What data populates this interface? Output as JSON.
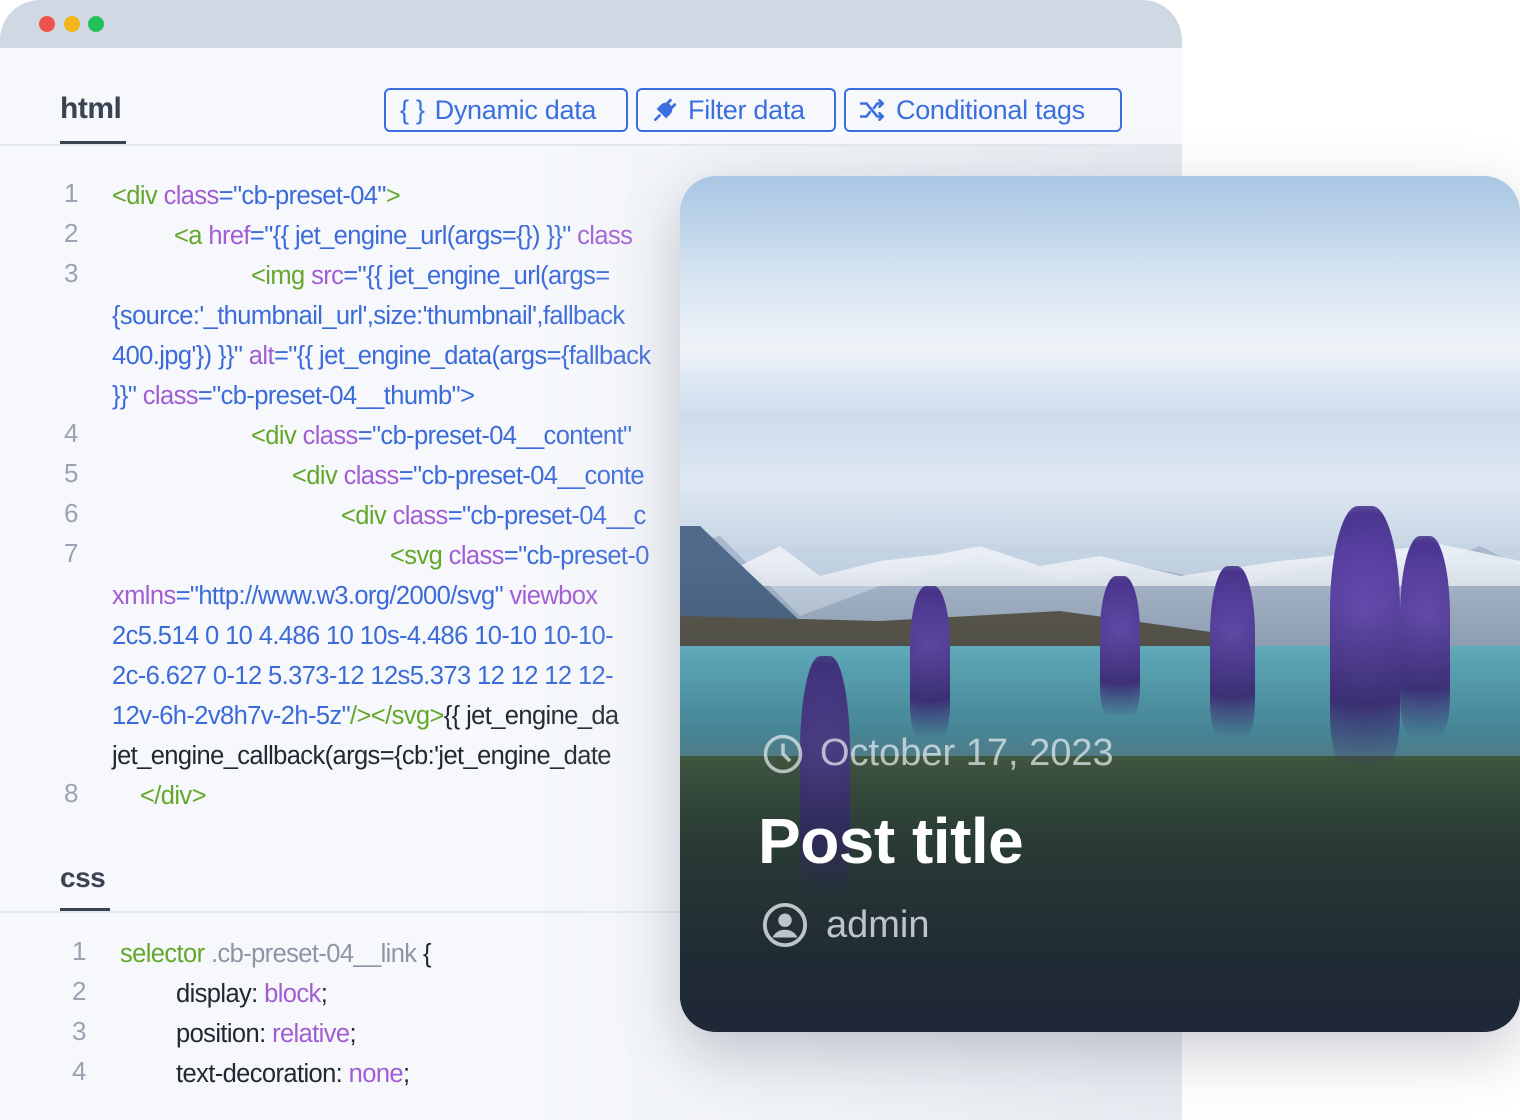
{
  "window": {
    "dots": [
      "#f0524f",
      "#f0b61a",
      "#22c05a"
    ]
  },
  "html_section": {
    "label": "html",
    "buttons": [
      {
        "label": "Dynamic data",
        "icon": "curly-braces-icon",
        "glyph": "{ }"
      },
      {
        "label": "Filter data",
        "icon": "plug-icon"
      },
      {
        "label": "Conditional tags",
        "icon": "shuffle-icon"
      }
    ],
    "lines": [
      {
        "num": "1",
        "indent": 0,
        "segs": [
          [
            "<div ",
            "tag"
          ],
          [
            "class",
            "attr"
          ],
          [
            "=\"cb-preset-04\"",
            "val"
          ],
          [
            ">",
            "tag"
          ]
        ]
      },
      {
        "num": "2",
        "indent": 1,
        "segs": [
          [
            "<a ",
            "tag"
          ],
          [
            "href",
            "attr"
          ],
          [
            "=\"{{ jet_engine_url(args={}) }}\" ",
            "val"
          ],
          [
            "class",
            "attr"
          ]
        ]
      },
      {
        "num": "3",
        "indent": 2,
        "segs": [
          [
            "<img ",
            "tag"
          ],
          [
            "src",
            "attr"
          ],
          [
            "=\"{{ jet_engine_url(args=",
            "val"
          ]
        ]
      },
      {
        "num": "",
        "indent": -1,
        "segs": [
          [
            "{source:'_thumbnail_url',size:'thumbnail',fallback",
            "val"
          ]
        ]
      },
      {
        "num": "",
        "indent": -1,
        "segs": [
          [
            "400.jpg'}) }}\" ",
            "val"
          ],
          [
            "alt",
            "attr"
          ],
          [
            "=\"{{ jet_engine_data(args={fallback",
            "val"
          ]
        ]
      },
      {
        "num": "",
        "indent": -1,
        "segs": [
          [
            "}}\" ",
            "val"
          ],
          [
            "class",
            "attr"
          ],
          [
            "=\"cb-preset-04__thumb\"",
            "val"
          ],
          [
            ">",
            "val"
          ]
        ]
      },
      {
        "num": "4",
        "indent": 2,
        "segs": [
          [
            "<div ",
            "tag"
          ],
          [
            "class",
            "attr"
          ],
          [
            "=\"cb-preset-04__content\"",
            "val"
          ]
        ]
      },
      {
        "num": "5",
        "indent": 3,
        "segs": [
          [
            "<div ",
            "tag"
          ],
          [
            "class",
            "attr"
          ],
          [
            "=\"cb-preset-04__conte",
            "val"
          ]
        ]
      },
      {
        "num": "6",
        "indent": 4,
        "segs": [
          [
            "<div ",
            "tag"
          ],
          [
            "class",
            "attr"
          ],
          [
            "=\"cb-preset-04__c",
            "val"
          ]
        ]
      },
      {
        "num": "7",
        "indent": 5,
        "segs": [
          [
            "<svg ",
            "tag"
          ],
          [
            "class",
            "attr"
          ],
          [
            "=\"cb-preset-0",
            "val"
          ]
        ]
      },
      {
        "num": "",
        "indent": -1,
        "segs": [
          [
            "xmlns",
            "attr"
          ],
          [
            "=\"http://www.w3.org/2000/svg\" ",
            "val"
          ],
          [
            "viewbox",
            "attr"
          ]
        ]
      },
      {
        "num": "",
        "indent": -1,
        "segs": [
          [
            "2c5.514 0 10 4.486 10 10s-4.486 10-10 10-10-",
            "val"
          ]
        ]
      },
      {
        "num": "",
        "indent": -1,
        "segs": [
          [
            "2c-6.627 0-12 5.373-12 12s5.373 12 12 12 12-",
            "val"
          ]
        ]
      },
      {
        "num": "",
        "indent": -1,
        "segs": [
          [
            "12v-6h-2v8h7v-2h-5z\"",
            "val"
          ],
          [
            "/></svg>",
            "tag"
          ],
          [
            "{{ jet_engine_da",
            "plain"
          ]
        ]
      },
      {
        "num": "",
        "indent": -1,
        "segs": [
          [
            "jet_engine_callback(args={cb:'jet_engine_date",
            "plain"
          ]
        ]
      },
      {
        "num": "8",
        "indent": 6,
        "segs": [
          [
            "</div>",
            "tag"
          ]
        ]
      }
    ]
  },
  "css_section": {
    "label": "css",
    "lines": [
      {
        "num": "1",
        "indent": 0,
        "segs": [
          [
            "selector ",
            "tag"
          ],
          [
            ".cb-preset-04__link ",
            "sel"
          ],
          [
            "{",
            "plain"
          ]
        ]
      },
      {
        "num": "2",
        "indent": 1,
        "segs": [
          [
            "display: ",
            "plain"
          ],
          [
            "block",
            "attr"
          ],
          [
            ";",
            "plain"
          ]
        ]
      },
      {
        "num": "3",
        "indent": 1,
        "segs": [
          [
            "position: ",
            "plain"
          ],
          [
            "relative",
            "attr"
          ],
          [
            ";",
            "plain"
          ]
        ]
      },
      {
        "num": "4",
        "indent": 1,
        "segs": [
          [
            "text-decoration: ",
            "plain"
          ],
          [
            "none",
            "attr"
          ],
          [
            ";",
            "plain"
          ]
        ]
      }
    ]
  },
  "preview_card": {
    "date": "October 17, 2023",
    "date_icon": "clock-icon",
    "title": "Post title",
    "author": "admin",
    "author_icon": "user-circle-icon"
  }
}
